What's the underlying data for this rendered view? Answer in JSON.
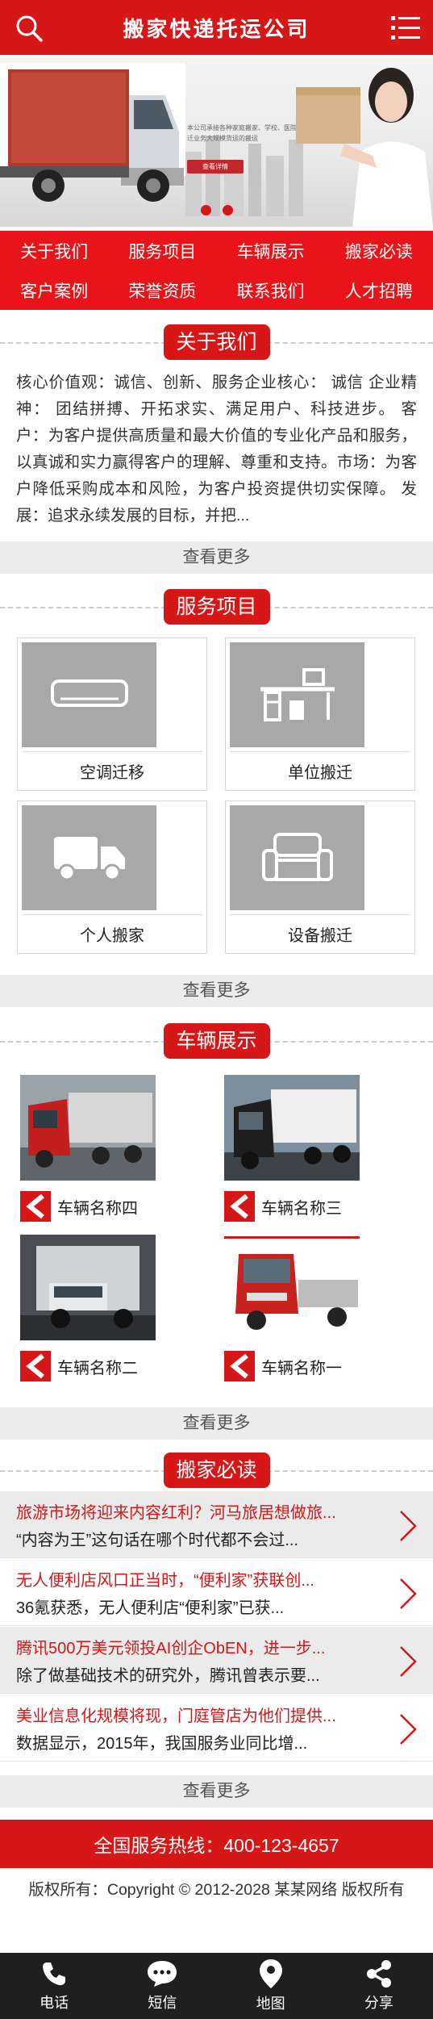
{
  "header": {
    "title": "搬家快递托运公司",
    "search_icon": "search-icon",
    "menu_icon": "menu-icon"
  },
  "banner": {
    "copy": "本公司承接各种家庭搬家、学校、医院、商务楼搬迁业务大规模货运的搬运",
    "cta": "查看详情",
    "slides": 2
  },
  "nav": [
    "关于我们",
    "服务项目",
    "车辆展示",
    "搬家必读",
    "客户案例",
    "荣誉资质",
    "联系我们",
    "人才招聘"
  ],
  "about": {
    "heading": "关于我们",
    "text": "核心价值观：诚信、创新、服务企业核心： 诚信 企业精神： 团结拼搏、开拓求实、满足用户、科技进步。 客户：为客户提供高质量和最大价值的专业化产品和服务，以真诚和实力赢得客户的理解、尊重和支持。市场：为客户降低采购成本和风险，为客户投资提供切实保障。 发展：追求永续发展的目标，并把...",
    "more": "查看更多"
  },
  "services": {
    "heading": "服务项目",
    "items": [
      {
        "label": "空调迁移",
        "icon": "air-conditioner-icon"
      },
      {
        "label": "单位搬迁",
        "icon": "office-desk-icon"
      },
      {
        "label": "个人搬家",
        "icon": "truck-icon"
      },
      {
        "label": "设备搬迁",
        "icon": "sofa-icon"
      }
    ],
    "more": "查看更多"
  },
  "vehicles": {
    "heading": "车辆展示",
    "items": [
      {
        "name": "车辆名称四"
      },
      {
        "name": "车辆名称三"
      },
      {
        "name": "车辆名称二"
      },
      {
        "name": "车辆名称一"
      }
    ],
    "more": "查看更多"
  },
  "news": {
    "heading": "搬家必读",
    "items": [
      {
        "title": "旅游市场将迎来内容红利？河马旅居想做旅...",
        "summary": "“内容为王”这句话在哪个时代都不会过..."
      },
      {
        "title": "无人便利店风口正当时，“便利家”获联创...",
        "summary": "36氪获悉，无人便利店“便利家”已获..."
      },
      {
        "title": "腾讯500万美元领投AI创企ObEN，进一步...",
        "summary": "除了做基础技术的研究外，腾讯曾表示要..."
      },
      {
        "title": "美业信息化规模将现，门庭管店为他们提供...",
        "summary": "数据显示，2015年，我国服务业同比增..."
      }
    ],
    "more": "查看更多"
  },
  "hotline": "全国服务热线：400-123-4657",
  "copyright": "版权所有：Copyright © 2012-2028 某某网络 版权所有",
  "bottom_bar": [
    {
      "label": "电话",
      "icon": "phone-icon"
    },
    {
      "label": "短信",
      "icon": "message-icon"
    },
    {
      "label": "地图",
      "icon": "map-pin-icon"
    },
    {
      "label": "分享",
      "icon": "share-icon"
    }
  ],
  "colors": {
    "brand_red": "#d71618",
    "nav_red": "#e8141a",
    "dark_bar": "#1f1f1f",
    "placeholder_gray": "#a8a8a8"
  }
}
